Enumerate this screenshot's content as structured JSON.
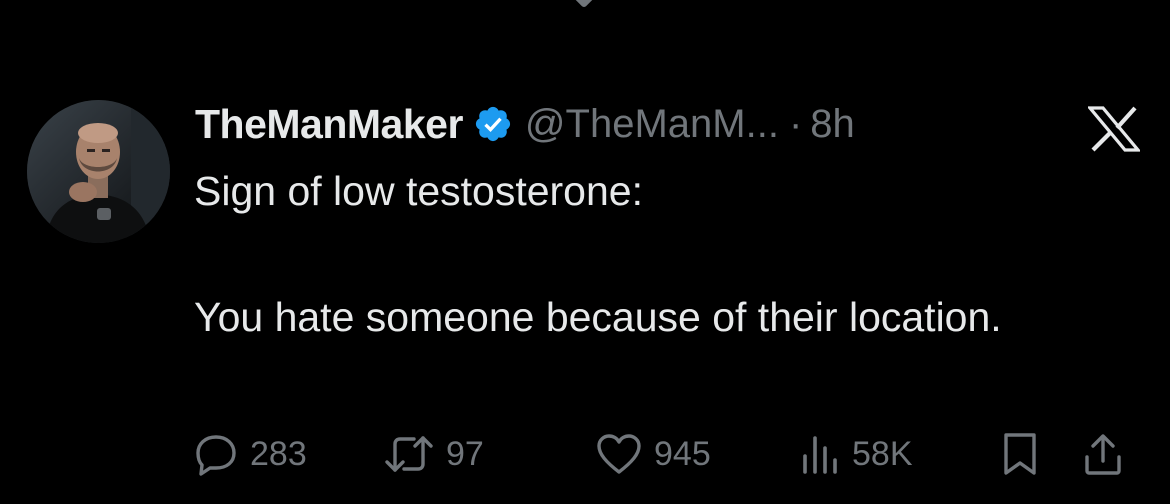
{
  "tweet": {
    "display_name": "TheManMaker",
    "handle": "@TheManM...",
    "separator": "·",
    "time": "8h",
    "text": "Sign of low testosterone:\n\nYou hate someone because of their location.",
    "verified": true
  },
  "actions": {
    "replies": "283",
    "reposts": "97",
    "likes": "945",
    "views": "58K"
  },
  "icons": {
    "top": "chevron-down-icon",
    "verified": "verified-badge-icon",
    "brand": "x-logo-icon",
    "reply": "reply-icon",
    "repost": "repost-icon",
    "like": "heart-icon",
    "views": "views-chart-icon",
    "bookmark": "bookmark-icon",
    "share": "share-icon"
  },
  "colors": {
    "background": "#000000",
    "text": "#e7e9ea",
    "secondary": "#71767b",
    "verified": "#1d9bf0"
  }
}
